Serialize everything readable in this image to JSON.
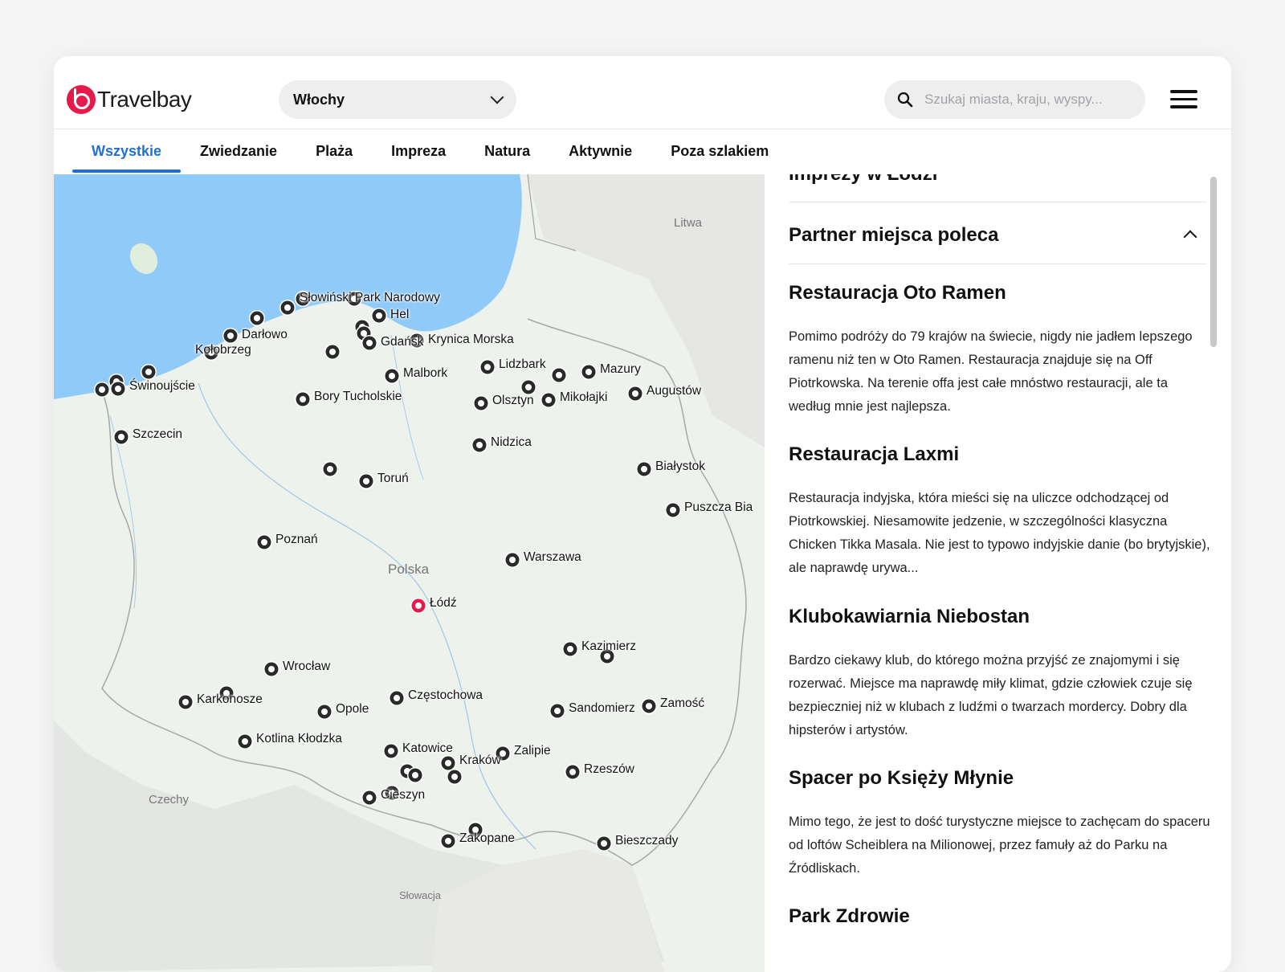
{
  "brand": {
    "name": "Travelbay",
    "accent": "#e6194b",
    "link_color": "#1f6fd6"
  },
  "header": {
    "country_selected": "Włochy",
    "search_placeholder": "Szukaj miasta, kraju, wyspy..."
  },
  "tabs": [
    {
      "label": "Wszystkie",
      "active": true
    },
    {
      "label": "Zwiedzanie",
      "active": false
    },
    {
      "label": "Plaża",
      "active": false
    },
    {
      "label": "Impreza",
      "active": false
    },
    {
      "label": "Natura",
      "active": false
    },
    {
      "label": "Aktywnie",
      "active": false
    },
    {
      "label": "Poza szlakiem",
      "active": false
    }
  ],
  "map": {
    "country_labels": [
      "Polska",
      "Litwa",
      "Czechy",
      "Słowacja"
    ],
    "places": [
      "Słowiński Park Narodowy",
      "Hel",
      "Darłowo",
      "Kołobrzeg",
      "Gdańsk",
      "Krynica Morska",
      "Świnoujście",
      "Malbork",
      "Lidzbark",
      "Mazury",
      "Bory Tucholskie",
      "Olsztyn",
      "Mikołajki",
      "Augustów",
      "Szczecin",
      "Nidzica",
      "Białystok",
      "Toruń",
      "Puszcza Bia",
      "Poznań",
      "Warszawa",
      "Łódź",
      "Kazimierz",
      "Wrocław",
      "Karkonosze",
      "Opole",
      "Częstochowa",
      "Sandomierz",
      "Zamość",
      "Kotlina Kłodzka",
      "Katowice",
      "Zalipie",
      "Kraków",
      "Rzeszów",
      "Cieszyn",
      "Zakopane",
      "Bieszczady"
    ],
    "selected_place": "Łódź"
  },
  "panel": {
    "clipped_heading": "Imprezy w Łodzi",
    "section_title": "Partner miejsca poleca",
    "entries": [
      {
        "title": "Restauracja Oto Ramen",
        "text": "Pomimo podróży do 79 krajów na świecie, nigdy nie jadłem lepszego ramenu niż ten w Oto Ramen. Restauracja znajduje się na Off Piotrkowska. Na terenie offa jest całe mnóstwo restauracji, ale ta według mnie jest najlepsza."
      },
      {
        "title": "Restauracja Laxmi",
        "text": "Restauracja indyjska, która mieści się na uliczce odchodzącej od Piotrkowskiej. Niesamowite jedzenie, w szczególności klasyczna Chicken Tikka Masala. Nie jest to typowo indyjskie danie (bo brytyjskie), ale naprawdę urywa..."
      },
      {
        "title": "Klubokawiarnia Niebostan",
        "text": "Bardzo ciekawy klub, do którego można przyjść ze znajomymi i się rozerwać. Miejsce ma naprawdę miły klimat, gdzie człowiek czuje się bezpieczniej niż w klubach z ludźmi o twarzach mordercy. Dobry dla hipsterów i artystów."
      },
      {
        "title": "Spacer po Księży Młynie",
        "text": "Mimo tego, że jest to dość turystyczne miejsce to zachęcam do spaceru od loftów Scheiblera na Milionowej, przez famuły aż do Parku na Źródliskach."
      },
      {
        "title": "Park Zdrowie",
        "text": ""
      }
    ]
  }
}
